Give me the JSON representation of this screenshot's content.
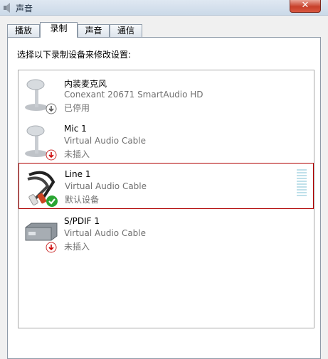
{
  "window": {
    "title": "声音",
    "close_glyph": "✕"
  },
  "tabs": [
    {
      "label": "播放",
      "active": false
    },
    {
      "label": "录制",
      "active": true
    },
    {
      "label": "声音",
      "active": false
    },
    {
      "label": "通信",
      "active": false
    }
  ],
  "instruction": "选择以下录制设备来修改设置:",
  "devices": [
    {
      "name": "内装麦克风",
      "description": "Conexant 20671 SmartAudio HD",
      "status": "已停用",
      "icon": "microphone-icon",
      "badge": "disabled-arrow-badge"
    },
    {
      "name": "Mic 1",
      "description": "Virtual Audio Cable",
      "status": "未插入",
      "icon": "microphone-icon",
      "badge": "unplugged-arrow-badge"
    },
    {
      "name": "Line 1",
      "description": "Virtual Audio Cable",
      "status": "默认设备",
      "icon": "rca-cable-icon",
      "badge": "default-check-badge",
      "selected": true
    },
    {
      "name": "S/PDIF 1",
      "description": "Virtual Audio Cable",
      "status": "未插入",
      "icon": "spdif-device-icon",
      "badge": "unplugged-arrow-badge"
    }
  ],
  "colors": {
    "selection_border": "#b00000",
    "secondary_text": "#707070",
    "meter": "#bfe0ea"
  }
}
